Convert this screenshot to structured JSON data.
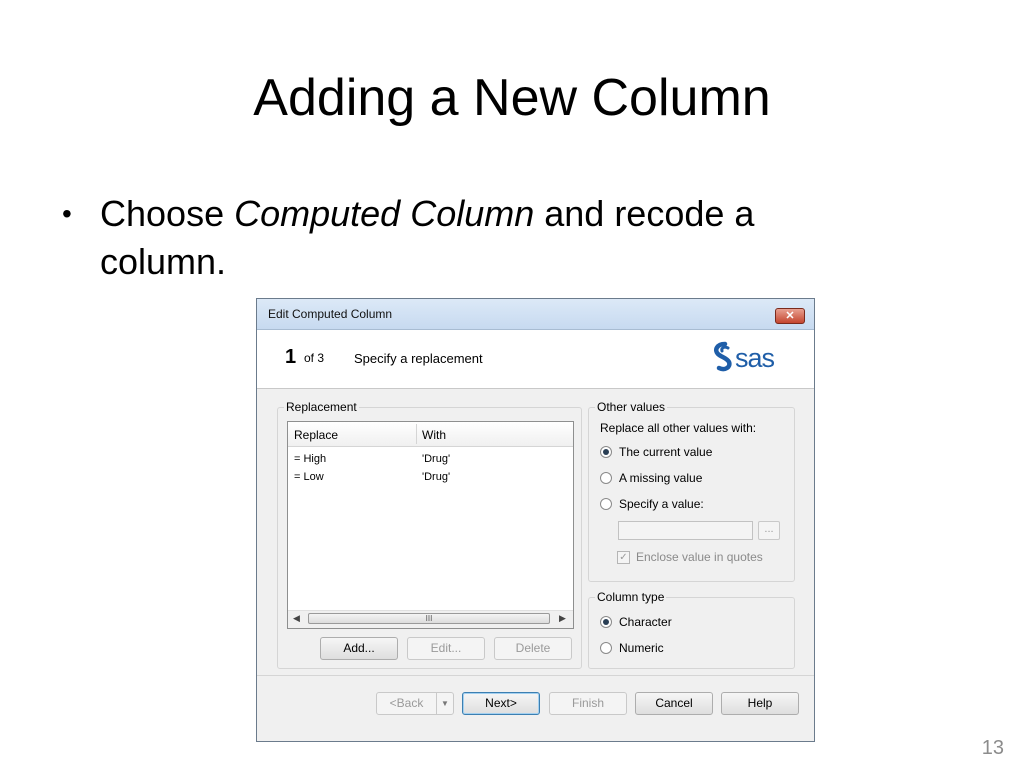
{
  "slide": {
    "title": "Adding a New Column",
    "bullet_prefix": "Choose ",
    "bullet_emphasis": "Computed Column",
    "bullet_suffix": " and recode a column.",
    "page_number": "13"
  },
  "dialog": {
    "title": "Edit Computed Column",
    "close_label": "✕",
    "step_number": "1",
    "step_of": "of 3",
    "step_title": "Specify a replacement",
    "logo_text": "sas",
    "replacement": {
      "group_label": "Replacement",
      "columns": [
        "Replace",
        "With"
      ],
      "rows": [
        {
          "replace": "= High",
          "with": "'Drug'"
        },
        {
          "replace": "= Low",
          "with": "'Drug'"
        }
      ],
      "scroll_left": "◀",
      "scroll_right": "▶",
      "scroll_grip": "III",
      "buttons": {
        "add": "Add...",
        "edit": "Edit...",
        "delete": "Delete"
      }
    },
    "other_values": {
      "group_label": "Other values",
      "prompt": "Replace all other values with:",
      "options": [
        "The current value",
        "A missing value",
        "Specify a value:"
      ],
      "selected": 0,
      "value_button": "...",
      "checkbox_label": "Enclose value in quotes",
      "checkbox_mark": "✓"
    },
    "column_type": {
      "group_label": "Column type",
      "options": [
        "Character",
        "Numeric"
      ],
      "selected": 0
    },
    "footer": {
      "back": "<Back",
      "back_dropdown": "▼",
      "next": "Next>",
      "finish": "Finish",
      "cancel": "Cancel",
      "help": "Help"
    }
  }
}
